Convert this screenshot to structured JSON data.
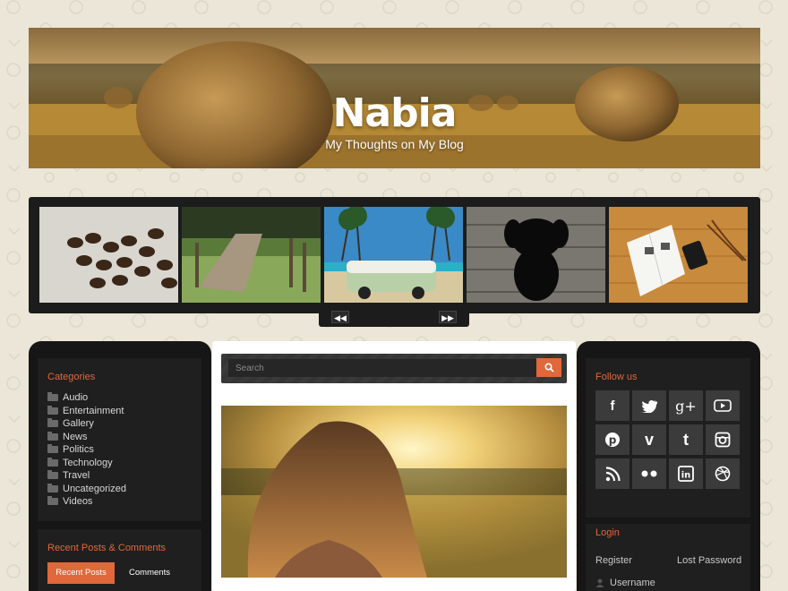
{
  "header": {
    "title": "Nabia",
    "tagline": "My Thoughts on My Blog"
  },
  "slider": {
    "slides": [
      "coffee-beans",
      "wooden-pier",
      "vw-van-beach",
      "black-puppy",
      "notebook-desk"
    ],
    "prev_icon": "rewind-icon",
    "next_icon": "fast-forward-icon"
  },
  "categories": {
    "title": "Categories",
    "items": [
      "Audio",
      "Entertainment",
      "Gallery",
      "News",
      "Politics",
      "Technology",
      "Travel",
      "Uncategorized",
      "Videos"
    ]
  },
  "recent": {
    "title": "Recent Posts & Comments",
    "tabs": [
      "Recent Posts",
      "Comments"
    ]
  },
  "search": {
    "placeholder": "Search"
  },
  "follow": {
    "title": "Follow us",
    "icons": [
      "facebook",
      "twitter",
      "google-plus",
      "youtube",
      "pinterest",
      "vimeo",
      "tumblr",
      "instagram",
      "rss",
      "flickr",
      "linkedin",
      "dribbble"
    ]
  },
  "login": {
    "title": "Login",
    "register": "Register",
    "lost_password": "Lost Password",
    "username_label": "Username"
  },
  "colors": {
    "accent": "#e0683a",
    "dark": "#161616",
    "page_bg": "#ebe6d7"
  }
}
